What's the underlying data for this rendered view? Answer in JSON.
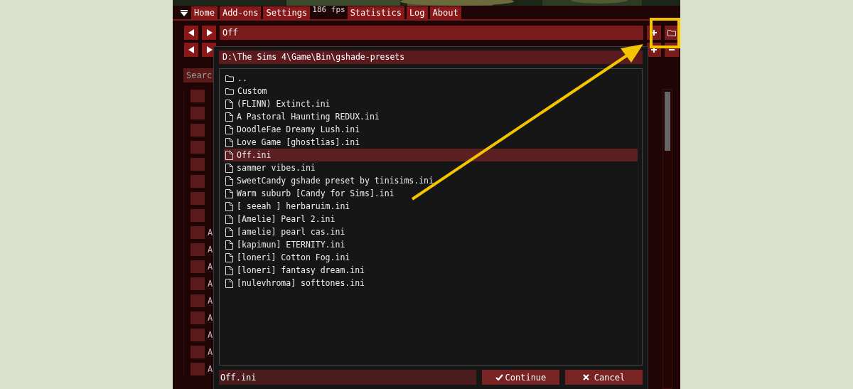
{
  "fps": "186 fps",
  "tabs": [
    {
      "label": "Home"
    },
    {
      "label": "Add-ons"
    },
    {
      "label": "Settings"
    },
    {
      "label": "Statistics"
    },
    {
      "label": "Log"
    },
    {
      "label": "About"
    }
  ],
  "preset_bar": {
    "value": "Off"
  },
  "search": {
    "placeholder": "Searc"
  },
  "techniques": [
    {
      "checked": false
    },
    {
      "checked": false
    },
    {
      "checked": false
    },
    {
      "checked": false
    },
    {
      "checked": false
    },
    {
      "checked": false
    },
    {
      "checked": false
    },
    {
      "checked": false
    },
    {
      "checked": false,
      "label": "A"
    },
    {
      "checked": false,
      "label": "A"
    },
    {
      "checked": false,
      "label": "A"
    },
    {
      "checked": false,
      "label": "A"
    },
    {
      "checked": false,
      "label": "A"
    },
    {
      "checked": false,
      "label": "A"
    },
    {
      "checked": false,
      "label": "A"
    },
    {
      "checked": false,
      "label": "A"
    },
    {
      "checked": false,
      "label": "A"
    }
  ],
  "file_dialog": {
    "path": "D:\\The Sims 4\\Game\\Bin\\gshade-presets",
    "entries": [
      {
        "kind": "folder",
        "name": "..",
        "selected": false
      },
      {
        "kind": "folder",
        "name": "Custom",
        "selected": false
      },
      {
        "kind": "file",
        "name": "(FLINN) Extinct.ini",
        "selected": false
      },
      {
        "kind": "file",
        "name": "A Pastoral Haunting REDUX.ini",
        "selected": false
      },
      {
        "kind": "file",
        "name": "DoodleFae Dreamy Lush.ini",
        "selected": false
      },
      {
        "kind": "file",
        "name": "Love Game [ghostlias].ini",
        "selected": false
      },
      {
        "kind": "file",
        "name": "Off.ini",
        "selected": true
      },
      {
        "kind": "file",
        "name": "sammer vibes.ini",
        "selected": false
      },
      {
        "kind": "file",
        "name": "SweetCandy gshade preset by tinisims.ini",
        "selected": false
      },
      {
        "kind": "file",
        "name": "Warm suburb [Candy for Sims].ini",
        "selected": false
      },
      {
        "kind": "file",
        "name": "[ seeah ] herbaruim.ini",
        "selected": false
      },
      {
        "kind": "file",
        "name": "[Amelie] Pearl 2.ini",
        "selected": false
      },
      {
        "kind": "file",
        "name": "[amelie] pearl cas.ini",
        "selected": false
      },
      {
        "kind": "file",
        "name": "[kapimun] ETERNITY.ini",
        "selected": false
      },
      {
        "kind": "file",
        "name": "[loneri] Cotton Fog.ini",
        "selected": false
      },
      {
        "kind": "file",
        "name": "[loneri] fantasy dream.ini",
        "selected": false
      },
      {
        "kind": "file",
        "name": "[nulevhroma] softtones.ini",
        "selected": false
      }
    ],
    "filename": "Off.ini",
    "buttons": [
      {
        "kind": "confirm",
        "label": "Continue"
      },
      {
        "kind": "cancel",
        "label": "Cancel"
      }
    ]
  }
}
